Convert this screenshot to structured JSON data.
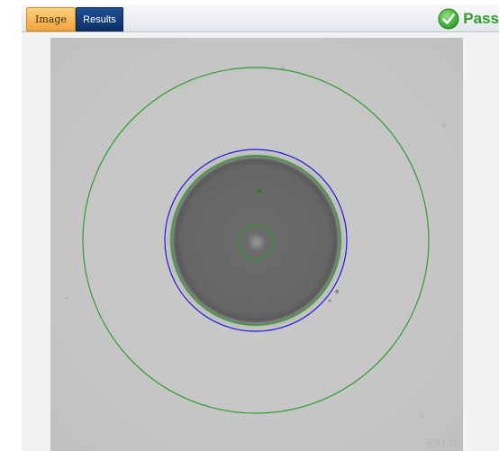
{
  "tabs": {
    "image_label": "Image",
    "results_label": "Results",
    "active": "Image"
  },
  "status": {
    "label": "Pass",
    "icon": "check-circle-icon",
    "color": "#2e9c2a"
  },
  "viewer": {
    "watermark": "EXFO",
    "zones": [
      {
        "name": "core-zone",
        "color": "#2e9c2a"
      },
      {
        "name": "cladding-boundary",
        "color": "#1a1ad6"
      },
      {
        "name": "cladding-zone",
        "color": "#2e9c2a"
      },
      {
        "name": "contact-zone",
        "color": "#2e9c2a"
      }
    ]
  },
  "colors": {
    "tab_image_active": "#f2a23c",
    "tab_results": "#0e2f66",
    "pass_green": "#2e9c2a",
    "cladding_blue": "#1a1ad6"
  }
}
